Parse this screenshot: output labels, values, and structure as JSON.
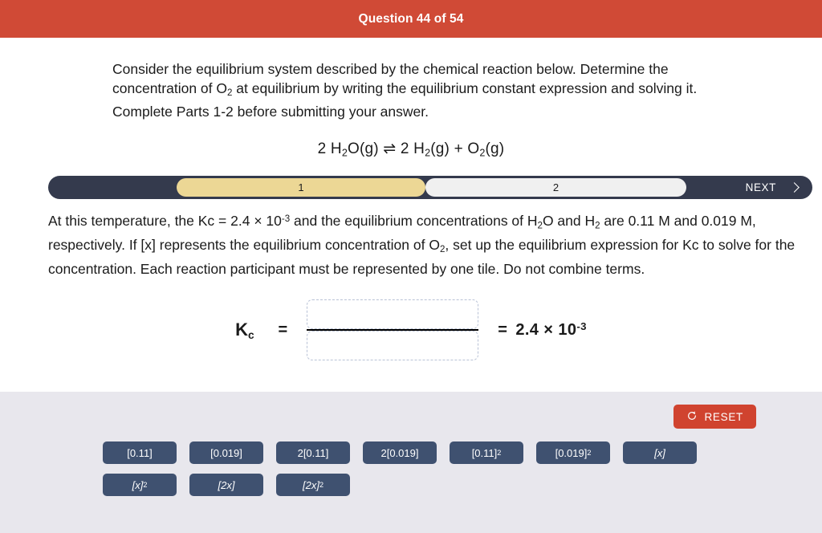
{
  "header": {
    "title": "Question 44 of 54",
    "bar_color": "#d04a36"
  },
  "question": {
    "intro_part1": "Consider the equilibrium system described by the chemical reaction below. Determine the concentration of O",
    "intro_sub1": "2",
    "intro_part2": " at equilibrium by writing the equilibrium constant expression and solving it. Complete Parts 1-2 before submitting your answer.",
    "equation": {
      "coefficient_reactant": "2 H",
      "sub_a": "2",
      "reactant_rest": "O(g)",
      "arrow": "⇌",
      "coefficient_product": "2 H",
      "sub_b": "2",
      "product_rest": "(g)",
      "plus": "+",
      "product2": "O",
      "sub_c": "2",
      "product2_rest": "(g)",
      "full_text": "2 H2O(g) ⇌ 2 H2(g) + O2(g)"
    }
  },
  "stepbar": {
    "step1_label": "1",
    "step2_label": "2",
    "next_label": "NEXT",
    "active_step": 1,
    "bar_color": "#343a4d",
    "active_color": "#ecd795",
    "inactive_color": "#f0f0f0"
  },
  "prompt": {
    "seg1": "At this temperature, the Kc = 2.4 × 10",
    "sup1": "-3",
    "seg2": " and the equilibrium concentrations of H",
    "sub1": "2",
    "seg3": "O and H",
    "sub2": "2",
    "seg4": " are 0.11 M and 0.019 M, respectively. If [x] represents the equilibrium concentration of O",
    "sub3": "2",
    "seg5": ", set up the equilibrium expression for Kc to solve for the concentration. Each reaction participant must be represented by one tile. Do not combine terms."
  },
  "answer": {
    "kc_label": "K",
    "kc_sub": "c",
    "equals": "=",
    "numerator_value": "",
    "denominator_value": "",
    "result_equals": "=",
    "result_value": "2.4 × 10",
    "result_sup": "-3"
  },
  "tray": {
    "reset_label": "RESET",
    "reset_icon": "rotate-ccw-icon",
    "reset_color": "#d0432f",
    "tile_color": "#3f5170",
    "tiles": [
      {
        "id": "tile-0-11",
        "text": "[0.11]",
        "base": "[0.11]",
        "exp": "",
        "italic": false
      },
      {
        "id": "tile-0-019",
        "text": "[0.019]",
        "base": "[0.019]",
        "exp": "",
        "italic": false
      },
      {
        "id": "tile-2-0-11",
        "text": "2[0.11]",
        "base": "2[0.11]",
        "exp": "",
        "italic": false
      },
      {
        "id": "tile-2-0-019",
        "text": "2[0.019]",
        "base": "2[0.019]",
        "exp": "",
        "italic": false
      },
      {
        "id": "tile-0-11-sq",
        "text": "[0.11]²",
        "base": "[0.11]",
        "exp": "2",
        "italic": false
      },
      {
        "id": "tile-0-019-sq",
        "text": "[0.019]²",
        "base": "[0.019]",
        "exp": "2",
        "italic": false
      },
      {
        "id": "tile-x",
        "text": "[x]",
        "base": "[x]",
        "exp": "",
        "italic": true
      },
      {
        "id": "tile-x-sq",
        "text": "[x]²",
        "base": "[x]",
        "exp": "2",
        "italic": true
      },
      {
        "id": "tile-2x",
        "text": "[2x]",
        "base": "[2x]",
        "exp": "",
        "italic": true
      },
      {
        "id": "tile-2x-sq",
        "text": "[2x]²",
        "base": "[2x]",
        "exp": "2",
        "italic": true
      }
    ]
  }
}
